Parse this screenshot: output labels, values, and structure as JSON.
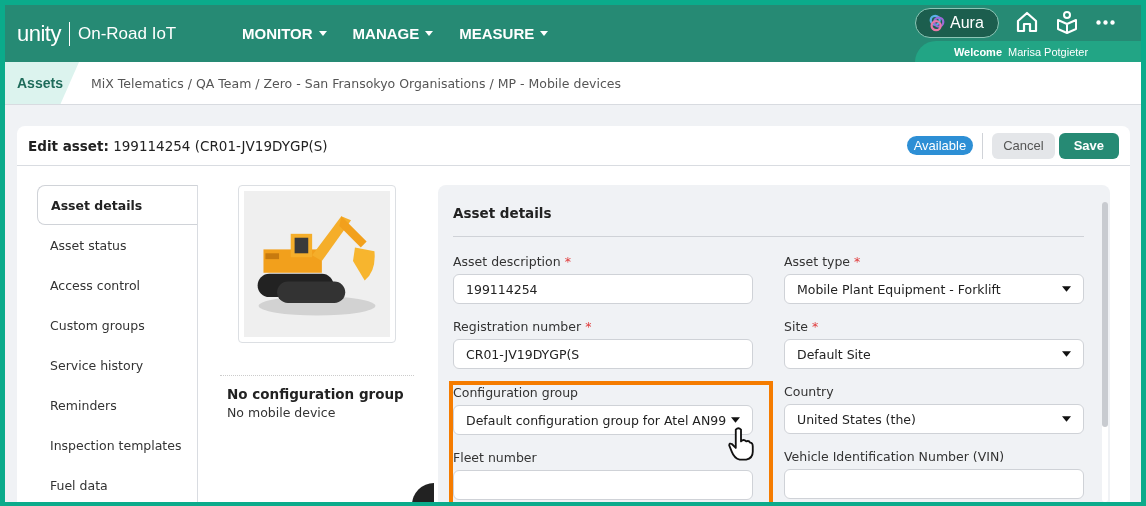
{
  "header": {
    "logo": "unity",
    "product": "On-Road IoT",
    "nav": [
      {
        "label": "MONITOR"
      },
      {
        "label": "MANAGE"
      },
      {
        "label": "MEASURE"
      }
    ],
    "aura": "Aura",
    "welcome": "Welcome",
    "user": "Marisa Potgieter"
  },
  "breadcrumb": {
    "section": "Assets",
    "path": "MiX Telematics / QA Team / Zero - San Fransokyo Organisations / MP - Mobile devices"
  },
  "page": {
    "title": "**Edit asset:** 199114254 (CR01-JV19DYGP(S)",
    "status": "Available",
    "buttons": [
      {
        "label": "Cancel",
        "kind": "secondary"
      },
      {
        "label": "Save",
        "kind": "primary"
      }
    ]
  },
  "sidebar": {
    "items": [
      {
        "label": "Asset details",
        "selected": true
      },
      {
        "label": "Asset status",
        "selected": false
      },
      {
        "label": "Access control",
        "selected": false
      },
      {
        "label": "Custom groups",
        "selected": false
      },
      {
        "label": "Service history",
        "selected": false
      },
      {
        "label": "Reminders",
        "selected": false
      },
      {
        "label": "Inspection templates",
        "selected": false
      },
      {
        "label": "Fuel data",
        "selected": false
      }
    ]
  },
  "asset_card": {
    "config_title": "No configuration group",
    "device": "No mobile device"
  },
  "form": {
    "title": "Asset details",
    "columns": [
      [
        {
          "label": "Asset description",
          "required_mark": "*",
          "kind": "input",
          "value": "199114254",
          "highlighted": false
        },
        {
          "label": "Registration number",
          "required_mark": "*",
          "kind": "input",
          "value": "CR01-JV19DYGP(S",
          "highlighted": false
        },
        {
          "label": "Configuration group",
          "kind": "select",
          "value": "Default configuration group for Atel AN99",
          "highlighted": true
        },
        {
          "label": "Fleet number",
          "kind": "input",
          "highlighted": true
        }
      ],
      [
        {
          "label": "Asset type",
          "required_mark": "*",
          "kind": "select",
          "value": "Mobile Plant Equipment - Forklift",
          "highlighted": false
        },
        {
          "label": "Site",
          "required_mark": "*",
          "kind": "select",
          "value": "Default Site",
          "highlighted": false
        },
        {
          "label": "Country",
          "kind": "select",
          "value": "United States (the)",
          "highlighted": false
        },
        {
          "label": "Vehicle Identification Number (VIN)",
          "kind": "input",
          "highlighted": false
        }
      ]
    ]
  }
}
